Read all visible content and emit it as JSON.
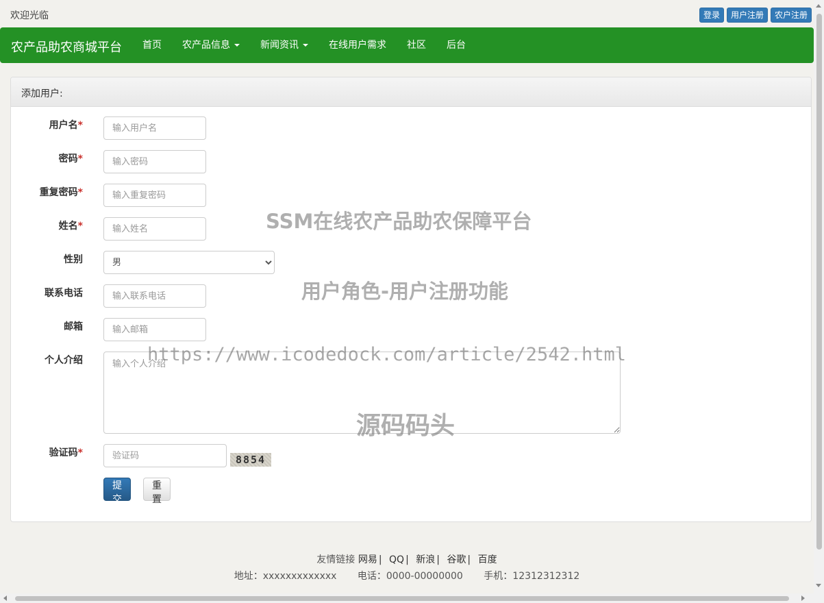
{
  "header": {
    "welcome": "欢迎光临",
    "buttons": [
      "登录",
      "用户注册",
      "农户注册"
    ]
  },
  "navbar": {
    "brand": "农产品助农商城平台",
    "items": [
      {
        "label": "首页",
        "dropdown": false
      },
      {
        "label": "农产品信息",
        "dropdown": true
      },
      {
        "label": "新闻资讯",
        "dropdown": true
      },
      {
        "label": "在线用户需求",
        "dropdown": false
      },
      {
        "label": "社区",
        "dropdown": false
      },
      {
        "label": "后台",
        "dropdown": false
      }
    ],
    "color": "#249125"
  },
  "panel": {
    "title": "添加用户:"
  },
  "form": {
    "username": {
      "label": "用户名",
      "required_mark": "*",
      "placeholder": "输入用户名"
    },
    "password": {
      "label": "密码",
      "required_mark": "*",
      "placeholder": "输入密码"
    },
    "repassword": {
      "label": "重复密码",
      "required_mark": "*",
      "placeholder": "输入重复密码"
    },
    "name": {
      "label": "姓名",
      "required_mark": "*",
      "placeholder": "输入姓名"
    },
    "gender": {
      "label": "性别",
      "selected": "男"
    },
    "phone": {
      "label": "联系电话",
      "placeholder": "输入联系电话"
    },
    "email": {
      "label": "邮箱",
      "placeholder": "输入邮箱"
    },
    "intro": {
      "label": "个人介绍",
      "placeholder": "输入个人介绍"
    },
    "captcha": {
      "label": "验证码",
      "required_mark": "*",
      "placeholder": "验证码",
      "code": "8854"
    },
    "submit_label": "提交",
    "reset_label": "重置"
  },
  "watermarks": {
    "line1": "SSM在线农产品助农保障平台",
    "line2": "用户角色-用户注册功能",
    "line3": "https://www.icodedock.com/article/2542.html",
    "line4": "源码码头"
  },
  "footer": {
    "links_label": "友情链接",
    "links": [
      "网易",
      "QQ",
      "新浪",
      "谷歌",
      "百度"
    ],
    "address": "地址：xxxxxxxxxxxxx",
    "phone": "电话：0000-00000000",
    "mobile": "手机：12312312312"
  }
}
